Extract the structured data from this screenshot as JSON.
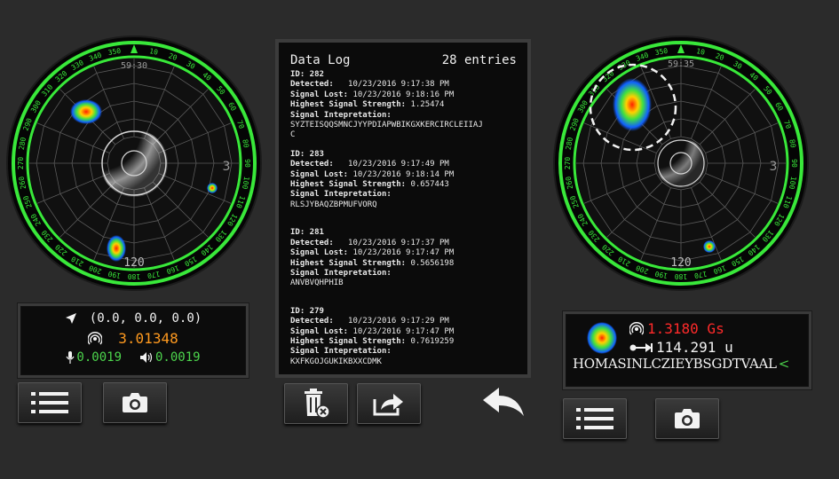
{
  "left_radar": {
    "time": "59:30",
    "center_number": "3",
    "bottom_number": "120",
    "compass_labels": [
      "350",
      "10",
      "20",
      "30",
      "40",
      "50",
      "60",
      "70",
      "80",
      "90",
      "100",
      "110",
      "120",
      "130",
      "140",
      "150",
      "160",
      "170",
      "180",
      "190",
      "200",
      "210",
      "220",
      "230",
      "240",
      "250",
      "260",
      "270",
      "280",
      "290",
      "300",
      "310",
      "320",
      "330",
      "340"
    ]
  },
  "left_readout": {
    "location": "(0.0, 0.0, 0.0)",
    "signal_value": "3.01348",
    "mic_value": "0.0019",
    "speaker_value": "0.0019",
    "colors": {
      "signal": "#ff9a1f",
      "green": "#4cd44c",
      "text": "#f2f2f2"
    }
  },
  "left_buttons": {
    "list": "list-icon",
    "camera": "camera-icon"
  },
  "data_log": {
    "title": "Data Log",
    "count": "28 entries",
    "entries": [
      {
        "id_label": "ID: 282",
        "detected_label": "Detected:",
        "detected": "10/23/2016 9:17:38 PM",
        "lost_label": "Signal Lost:",
        "lost": "10/23/2016 9:18:16 PM",
        "strength_label": "Highest Signal Strength:",
        "strength": "1.25474",
        "interp_label": "Signal Intepretation:",
        "interp_line1": "SYZTEISQQSMNCJYYPDIAPWBIKGXKERCIRCLEIIAJ",
        "interp_line2": "C"
      },
      {
        "id_label": "ID: 283",
        "detected_label": "Detected:",
        "detected": "10/23/2016 9:17:49 PM",
        "lost_label": "Signal Lost:",
        "lost": "10/23/2016 9:18:14 PM",
        "strength_label": "Highest Signal Strength:",
        "strength": "0.657443",
        "interp_label": "Signal Intepretation:",
        "interp_line1": "RLSJYBAQZBPMUFVORQ",
        "interp_line2": ""
      },
      {
        "id_label": "ID: 281",
        "detected_label": "Detected:",
        "detected": "10/23/2016 9:17:37 PM",
        "lost_label": "Signal Lost:",
        "lost": "10/23/2016 9:17:47 PM",
        "strength_label": "Highest Signal Strength:",
        "strength": "0.5656198",
        "interp_label": "Signal Intepretation:",
        "interp_line1": "ANVBVQHPHIB",
        "interp_line2": ""
      },
      {
        "id_label": "ID: 279",
        "detected_label": "Detected:",
        "detected": "10/23/2016 9:17:29 PM",
        "lost_label": "Signal Lost:",
        "lost": "10/23/2016 9:17:47 PM",
        "strength_label": "Highest Signal Strength:",
        "strength": "0.7619259",
        "interp_label": "Signal Intepretation:",
        "interp_line1": "KXFKGOJGUKIKBXXCDMK",
        "interp_line2": ""
      }
    ]
  },
  "middle_buttons": {
    "delete": "trash-x-icon",
    "share": "share-icon",
    "back": "back-arrow-icon"
  },
  "right_radar": {
    "time": "59:35",
    "center_number": "3",
    "bottom_number": "120",
    "compass_labels": [
      "350",
      "10",
      "20",
      "30",
      "40",
      "50",
      "60",
      "70",
      "80",
      "90",
      "100",
      "110",
      "120",
      "130",
      "140",
      "150",
      "160",
      "170",
      "180",
      "190",
      "200",
      "210",
      "220",
      "230",
      "240",
      "250",
      "260",
      "270",
      "280",
      "290",
      "300",
      "310",
      "320",
      "330",
      "340"
    ]
  },
  "right_readout": {
    "field_value": "1.3180 Gs",
    "distance_value": "114.291 u",
    "decoded_text": "HOMASINLCZIEYBSGDTVAAL",
    "cursor": "<",
    "colors": {
      "field": "#ff2a2a",
      "text": "#f2f2f2",
      "cursor": "#4cd44c"
    }
  },
  "right_buttons": {
    "list": "list-icon",
    "camera": "camera-icon"
  }
}
